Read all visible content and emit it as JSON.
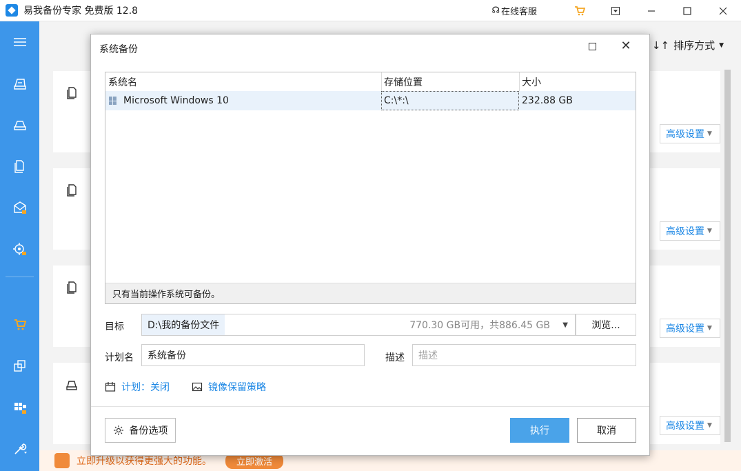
{
  "app": {
    "title": "易我备份专家 免费版 12.8",
    "service_label": "在线客服"
  },
  "main": {
    "sort_label": "排序方式",
    "advanced_label": "高级设置",
    "promo_text": "立即升级以获得更强大的功能。",
    "promo_button": "立即激活"
  },
  "dialog": {
    "title": "系统备份",
    "table": {
      "headers": [
        "系统名",
        "存储位置",
        "大小"
      ],
      "rows": [
        {
          "name": "Microsoft Windows 10",
          "location": "C:\\*:\\",
          "size": "232.88 GB"
        }
      ],
      "note": "只有当前操作系统可备份。"
    },
    "target_label": "目标",
    "target_path": "D:\\我的备份文件",
    "target_space": "770.30 GB可用，共886.45 GB",
    "browse_label": "浏览...",
    "plan_label": "计划名",
    "plan_value": "系统备份",
    "desc_label": "描述",
    "desc_placeholder": "描述",
    "schedule_link": "计划：关闭",
    "image_policy_link": "镜像保留策略",
    "options_button": "备份选项",
    "run_button": "执行",
    "cancel_button": "取消"
  }
}
